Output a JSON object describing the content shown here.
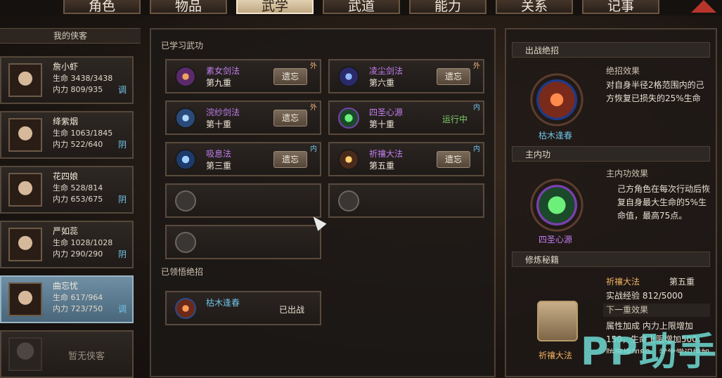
{
  "tabs": [
    "角色",
    "物品",
    "武学",
    "武道",
    "能力",
    "关系",
    "记事"
  ],
  "active_tab": "武学",
  "left_panel": {
    "header": "我的侠客",
    "heroes": [
      {
        "name": "詹小虾",
        "hp": "生命 3438/3438",
        "mp": "内力 809/935",
        "tag": "调"
      },
      {
        "name": "绛紫烟",
        "hp": "生命 1063/1845",
        "mp": "内力 522/640",
        "tag": "阴"
      },
      {
        "name": "花四娘",
        "hp": "生命 528/814",
        "mp": "内力 653/675",
        "tag": "阴"
      },
      {
        "name": "严如蕊",
        "hp": "生命 1028/1028",
        "mp": "内力 290/290",
        "tag": "阴"
      },
      {
        "name": "曲忘忧",
        "hp": "生命 617/964",
        "mp": "内力 723/750",
        "tag": "调"
      }
    ],
    "empty_slot": "暂无侠客"
  },
  "middle_panel": {
    "learned_title": "已学习武功",
    "skills": [
      {
        "name": "素女剑法",
        "level": "第九重",
        "button": "遗忘",
        "badge": "外"
      },
      {
        "name": "凌尘剑法",
        "level": "第六重",
        "button": "遗忘",
        "badge": "外"
      },
      {
        "name": "浣纱剑法",
        "level": "第十重",
        "button": "遗忘",
        "badge": "外"
      },
      {
        "name": "四圣心源",
        "level": "第十重",
        "status": "运行中",
        "badge": "内"
      },
      {
        "name": "吸息法",
        "level": "第三重",
        "button": "遗忘",
        "badge": "内"
      },
      {
        "name": "祈禳大法",
        "level": "第五重",
        "button": "遗忘",
        "badge": "内"
      }
    ],
    "ultimate_title": "已领悟绝招",
    "ultimate": {
      "name": "枯木逢春",
      "status": "已出战"
    }
  },
  "right_panel": {
    "section1": {
      "title": "出战绝招",
      "effect_title": "绝招效果",
      "effect_text": "对自身半径2格范围内的己方恢复已损失的25%生命",
      "name": "枯木逢春"
    },
    "section2": {
      "title": "主内功",
      "effect_title": "主内功效果",
      "effect_text": "己方角色在每次行动后恢复自身最大生命的5%生命值，最高75点。",
      "name": "四圣心源"
    },
    "section3": {
      "title": "修炼秘籍",
      "book_name": "祈禳大法",
      "book_level": "第五重",
      "exp": "实战经验  812/5000",
      "next_label": "下一重效果",
      "next_text": "属性加成  内力上限增加150，生命上限增加500，防御增加80，武学常识增加35",
      "book_label": "祈禳大法"
    }
  },
  "watermark": "PP助手",
  "colors": {
    "accent_teal": "#6fc3e8",
    "skill_purple": "#c37ef0",
    "status_green": "#7fd069",
    "active_tab": "#e8d9bd",
    "selected_hero": "#5d7f97"
  }
}
